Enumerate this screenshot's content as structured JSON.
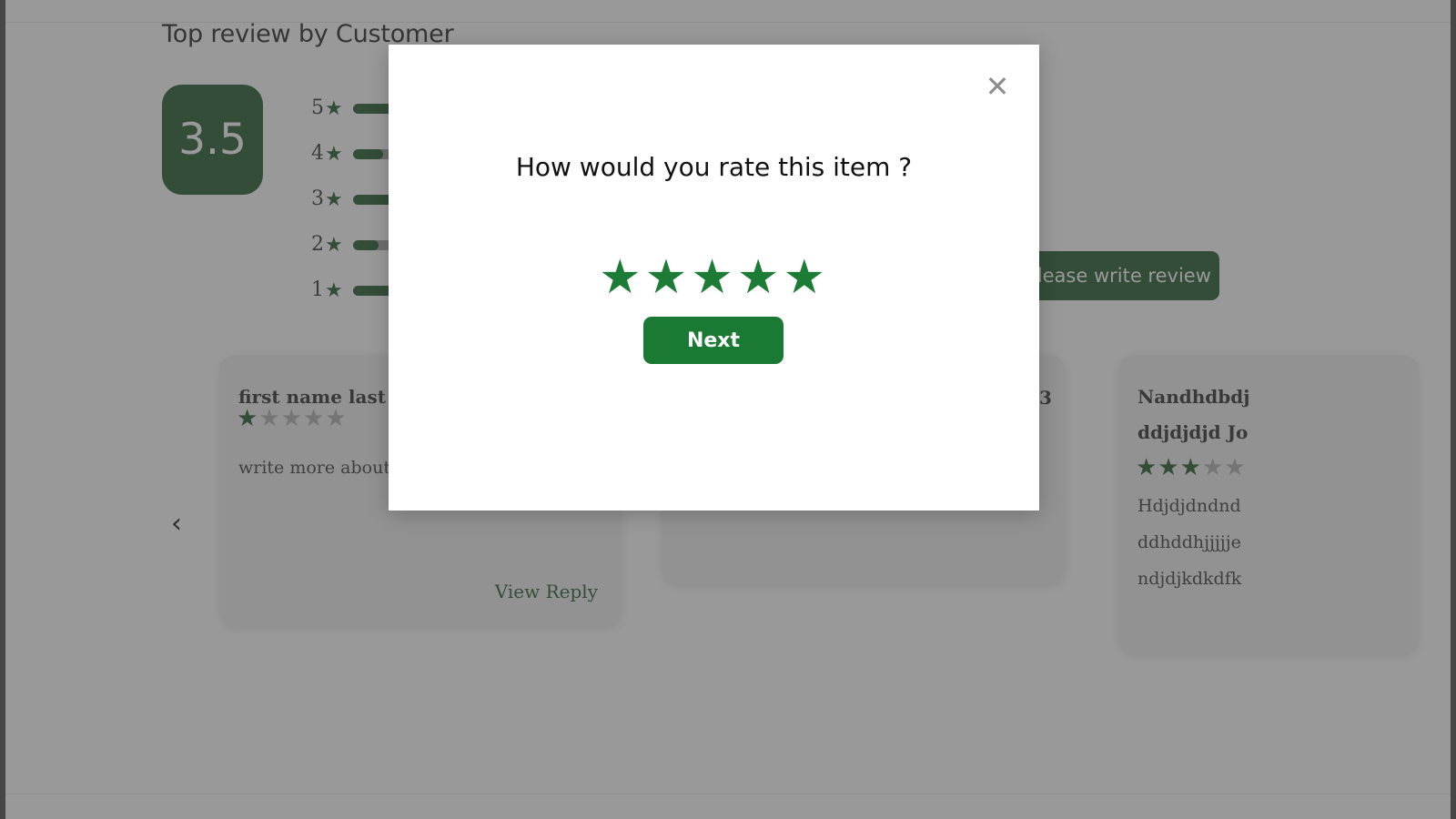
{
  "page": {
    "section_title": "Top review by Customer",
    "average_score": "3.5",
    "write_review_label": "Please write review",
    "prev_arrow": "‹",
    "next_arrow": "›",
    "star_glyph": "★",
    "close_glyph": "✕"
  },
  "colors": {
    "brand_dark_green": "#0E4A1B",
    "accent_green": "#1A7A33",
    "star_green": "#1C7C35",
    "star_off_gray": "#a9a9a9",
    "card_bg": "#efefef",
    "overlay": "rgba(80,80,80,0.58)"
  },
  "chart_data": {
    "type": "bar",
    "title": "Top review by Customer",
    "orientation": "horizontal",
    "categories": [
      "5",
      "4",
      "3",
      "2",
      "1"
    ],
    "values": [
      19,
      7,
      12,
      6,
      10
    ],
    "ylim": [
      0,
      100
    ],
    "xlabel": "",
    "ylabel": "",
    "grid": false,
    "legend": null,
    "average": 3.5,
    "bars": [
      {
        "stars": "5",
        "label": "5",
        "percent": 19
      },
      {
        "stars": "4",
        "label": "4",
        "percent": 7
      },
      {
        "stars": "3",
        "label": "3",
        "percent": 12
      },
      {
        "stars": "2",
        "label": "2",
        "percent": 6
      },
      {
        "stars": "1",
        "label": "1",
        "percent": 10
      }
    ]
  },
  "reviews": [
    {
      "name": "first name last name",
      "name2": "",
      "rating": 1,
      "body_lines": [
        "write more about it"
      ],
      "view_reply_label": "View Reply"
    },
    {
      "name": "",
      "name2": "",
      "rating": 0,
      "trailing_number": "3",
      "body_lines": []
    },
    {
      "name": "Nandhdbdj",
      "name2": "ddjdjdjd Jo",
      "rating": 3,
      "body_lines": [
        "Hdjdjdndnd",
        "ddhddhjjjjje",
        "ndjdjkdkdfk"
      ]
    }
  ],
  "modal": {
    "question": "How would you rate this item ?",
    "selected_rating": 5,
    "total_stars": 5,
    "next_label": "Next",
    "close_label": "✕"
  }
}
